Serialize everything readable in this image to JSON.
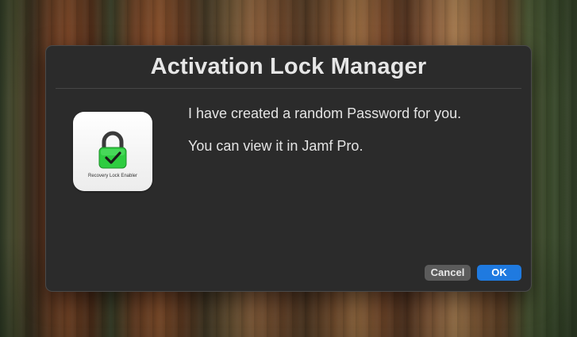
{
  "dialog": {
    "title": "Activation Lock Manager",
    "messages": [
      "I have created a random Password for you.",
      "You can view it in Jamf Pro."
    ],
    "app_icon": {
      "icon_name": "padlock-check-icon",
      "label": "Recovery Lock Enabler",
      "lock_color": "#2ecc40"
    },
    "buttons": {
      "cancel_label": "Cancel",
      "ok_label": "OK"
    },
    "accent_color": "#1f7ae0"
  },
  "desktop": {
    "background": "redwood-forest-wallpaper"
  }
}
